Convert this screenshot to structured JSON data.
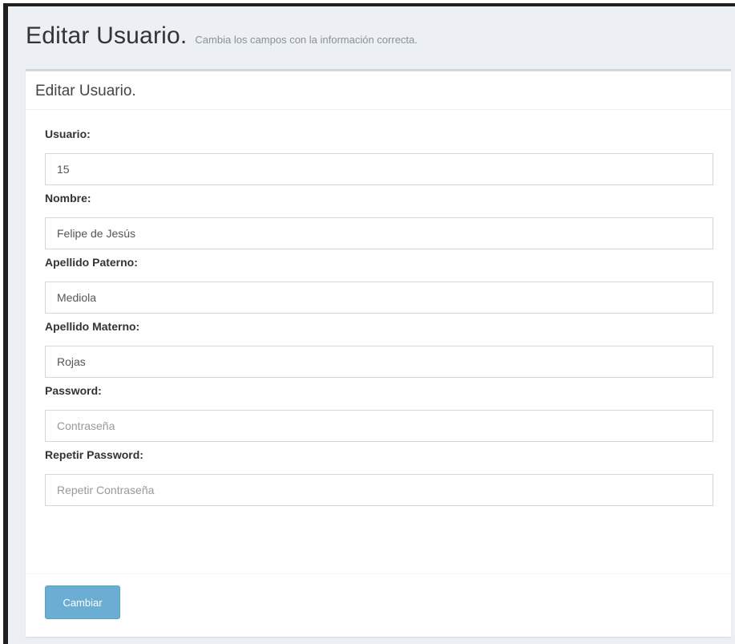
{
  "header": {
    "title": "Editar Usuario.",
    "subtitle": "Cambia los campos con la información correcta."
  },
  "box": {
    "title": "Editar Usuario."
  },
  "form": {
    "fields": [
      {
        "label": "Usuario:",
        "value": "15",
        "placeholder": ""
      },
      {
        "label": "Nombre:",
        "value": "Felipe de Jesús",
        "placeholder": ""
      },
      {
        "label": "Apellido Paterno:",
        "value": "Mediola",
        "placeholder": ""
      },
      {
        "label": "Apellido Materno:",
        "value": "Rojas",
        "placeholder": ""
      },
      {
        "label": "Password:",
        "value": "",
        "placeholder": "Contraseña"
      },
      {
        "label": "Repetir Password:",
        "value": "",
        "placeholder": "Repetir Contraseña"
      }
    ],
    "submit_label": "Cambiar"
  },
  "colors": {
    "background": "#ecf0f5",
    "button": "#6cadd3"
  }
}
